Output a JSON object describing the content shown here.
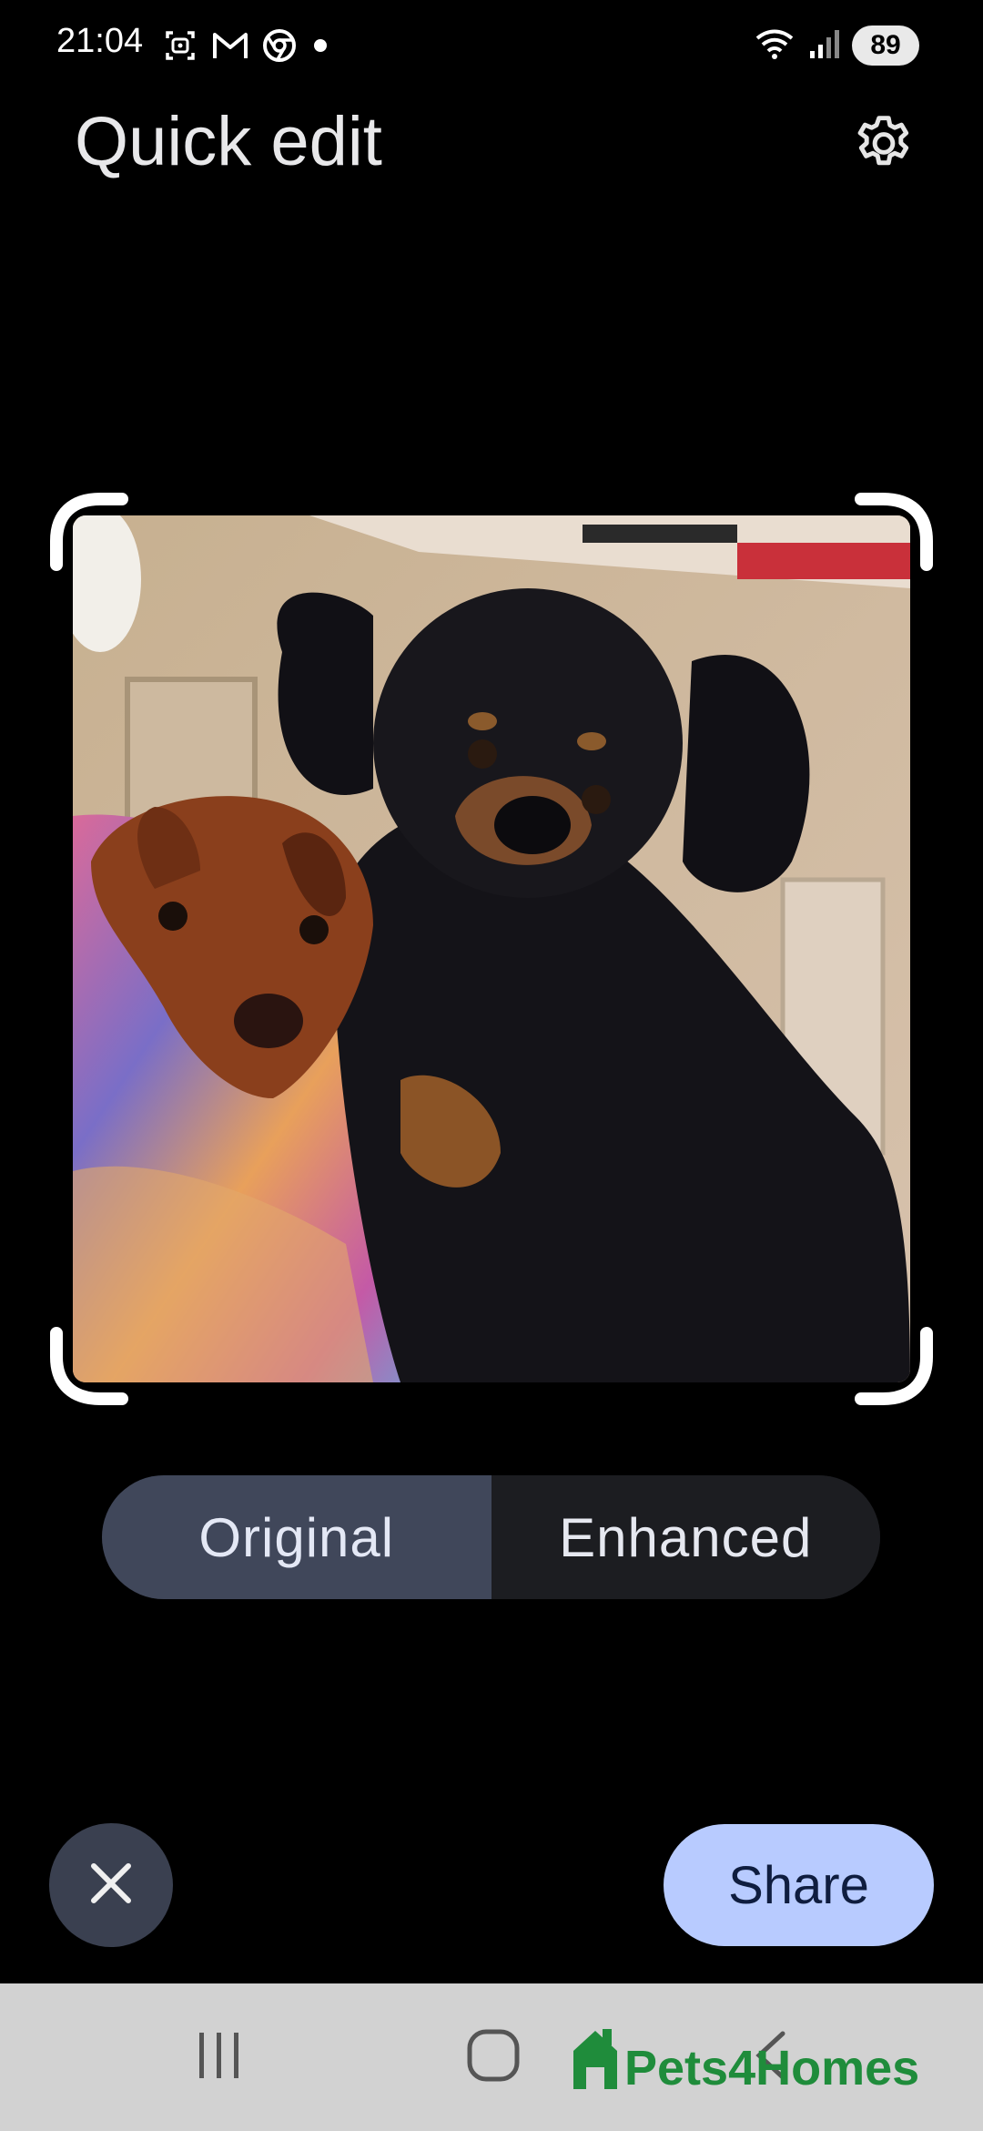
{
  "status_bar": {
    "time": "21:04",
    "left_icons": [
      "screenshot-icon",
      "gmail-icon",
      "chrome-icon",
      "dot-icon"
    ],
    "right_icons": [
      "wifi-icon",
      "signal-icon"
    ],
    "battery": "89"
  },
  "header": {
    "title": "Quick edit",
    "settings_icon": "gear-icon"
  },
  "photo": {
    "subject": "photo"
  },
  "toggle": {
    "options": [
      {
        "label": "Original",
        "selected": true
      },
      {
        "label": "Enhanced",
        "selected": false
      }
    ]
  },
  "actions": {
    "close_icon": "close-icon",
    "share_label": "Share"
  },
  "nav_bar": {
    "recents_icon": "recents-icon",
    "home_icon": "home-icon",
    "back_icon": "back-icon"
  },
  "watermark": {
    "text": "Pets4Homes"
  },
  "colors": {
    "background": "#000000",
    "toggle_active": "#40475a",
    "toggle_inactive": "#1c1d21",
    "share_bg": "#b8cbff",
    "close_bg": "#3a4050",
    "nav_bg": "#d2d2d2",
    "watermark": "#1f8c3b"
  }
}
